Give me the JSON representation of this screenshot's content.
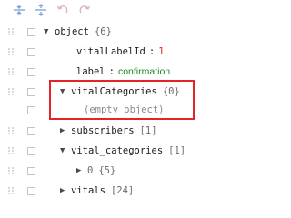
{
  "toolbar": {
    "expand_all_icon": "expand-all-icon",
    "collapse_all_icon": "collapse-all-icon",
    "undo_icon": "undo-icon",
    "redo_icon": "redo-icon"
  },
  "tree": {
    "root": {
      "key": "object",
      "meta": "{6}"
    },
    "vitalLabelId": {
      "key": "vitalLabelId",
      "value": "1"
    },
    "label": {
      "key": "label",
      "value": "confirmation"
    },
    "vitalCategories": {
      "key": "vitalCategories",
      "meta": "{0}",
      "empty_text": "(empty object)"
    },
    "subscribers": {
      "key": "subscribers",
      "meta": "[1]"
    },
    "vital_categories": {
      "key": "vital_categories",
      "meta": "[1]"
    },
    "vital_categories_item0": {
      "key": "0",
      "meta": "{5}"
    },
    "vitals": {
      "key": "vitals",
      "meta": "[24]"
    }
  },
  "colors": {
    "number_value": "#e0242a",
    "string_value": "#118a1a",
    "highlight_border": "#e3242b",
    "toolbar_icon": "#7ea6d8"
  }
}
